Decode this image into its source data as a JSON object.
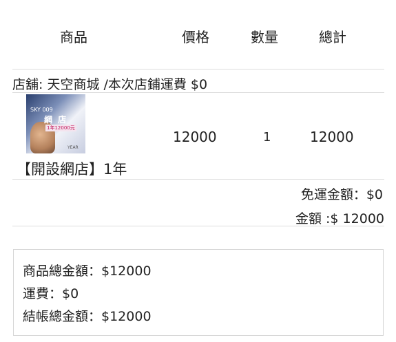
{
  "header": {
    "product": "商品",
    "price": "價格",
    "quantity": "數量",
    "total": "總計"
  },
  "shop_line": "店舖: 天空商城 /本次店鋪運費 $0",
  "item": {
    "image_text": {
      "code": "SKY 009",
      "title": "網 店",
      "price_badge": "1年12000元",
      "year": "YEAR"
    },
    "price": "12000",
    "quantity": "1",
    "total": "12000",
    "name": "【開設網店】1年"
  },
  "free_shipping": "免運金額：$0",
  "amount": "金額 :$ 12000",
  "summary": {
    "goods_total": "商品總金額：$12000",
    "shipping": "運費：$0",
    "checkout_total": "結帳總金額：$12000"
  }
}
